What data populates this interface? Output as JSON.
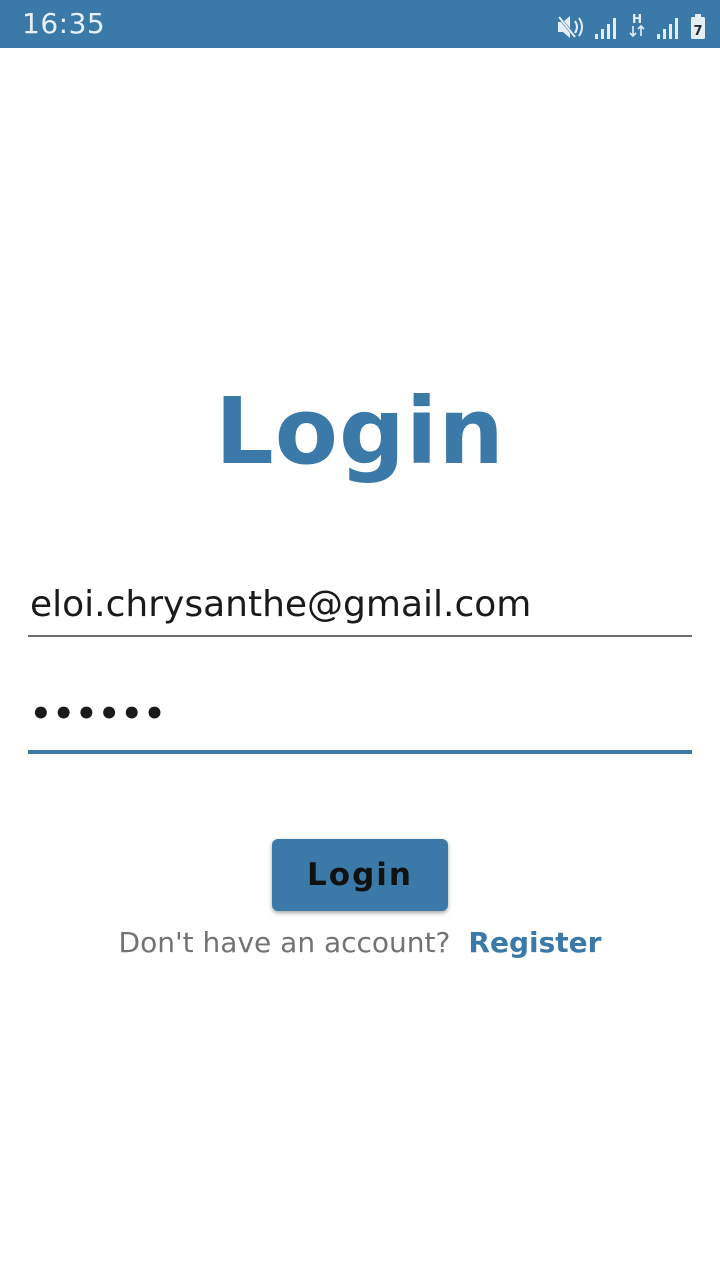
{
  "status_bar": {
    "time": "16:35",
    "icons": [
      "vibrate-mute-icon",
      "signal-icon",
      "data-h-icon",
      "signal-icon",
      "battery-icon"
    ],
    "network_type": "H",
    "battery_level": "7"
  },
  "login_screen": {
    "title": "Login",
    "email_value": "eloi.chrysanthe@gmail.com",
    "password_value": "••••••",
    "login_button_label": "Login",
    "register_prompt": "Don't have an account?",
    "register_link_label": "Register"
  },
  "colors": {
    "accent": "#3b7aa8",
    "text": "#1a1a1a",
    "muted": "#737373",
    "background": "#ffffff"
  }
}
